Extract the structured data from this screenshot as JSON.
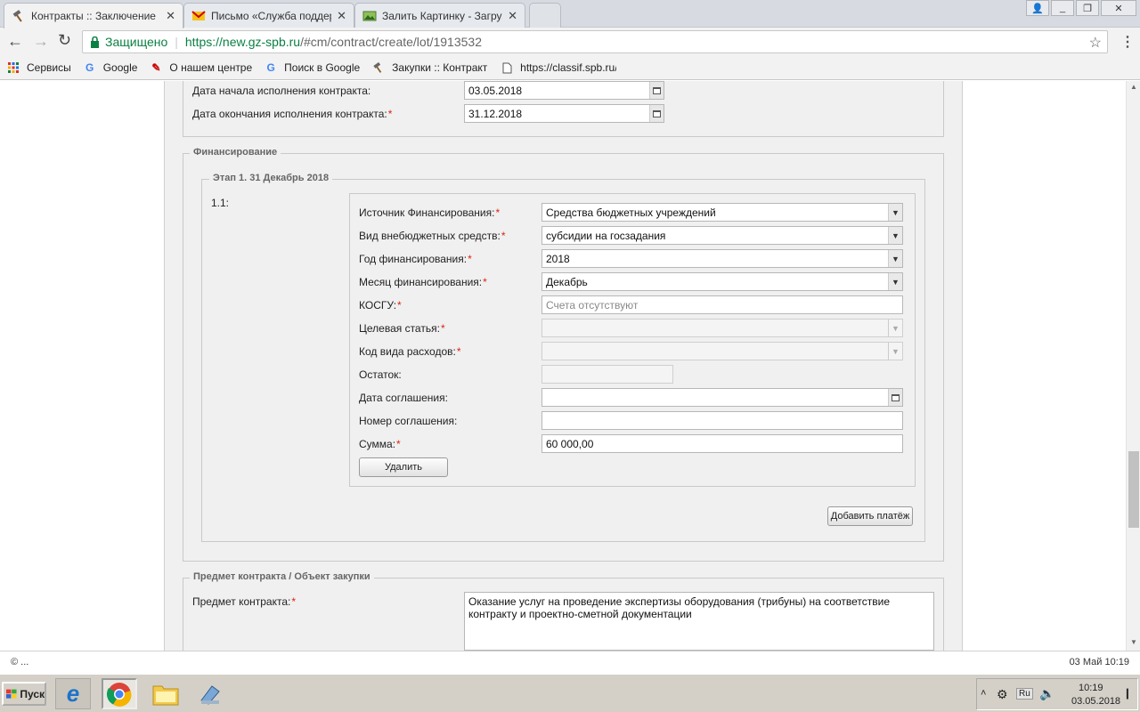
{
  "browser": {
    "tabs": [
      {
        "title": "Контракты :: Заключение",
        "icon": "hammer-icon"
      },
      {
        "title": "Письмо «Служба поддерж",
        "icon": "mail-icon"
      },
      {
        "title": "Залить Картинку - Загрузи",
        "icon": "image-icon"
      }
    ],
    "secure_label": "Защищено",
    "url_host": "https://new.gz-spb.ru",
    "url_path": "/#cm/contract/create/lot/1913532",
    "bookmarks": [
      {
        "label": "Сервисы",
        "icon": "apps-grid-icon"
      },
      {
        "label": "Google",
        "icon": "google-icon"
      },
      {
        "label": "О нашем центре",
        "icon": "sign-icon"
      },
      {
        "label": "Поиск в Google",
        "icon": "google-icon"
      },
      {
        "label": "Закупки :: Контракты",
        "icon": "hammer-icon"
      },
      {
        "label": "https://classif.spb.ru/c",
        "icon": "page-icon"
      }
    ]
  },
  "contract_dates": {
    "start_label": "Дата начала исполнения контракта:",
    "start_value": "03.05.2018",
    "end_label": "Дата окончания исполнения контракта:",
    "end_value": "31.12.2018"
  },
  "financing": {
    "legend": "Финансирование",
    "stage_legend": "Этап 1. 31 Декабрь 2018",
    "item_index": "1.1:",
    "fields": {
      "source_label": "Источник Финансирования:",
      "source_value": "Средства бюджетных учреждений",
      "extrabudget_label": "Вид внебюджетных средств:",
      "extrabudget_value": "субсидии на госзадания",
      "year_label": "Год финансирования:",
      "year_value": "2018",
      "month_label": "Месяц финансирования:",
      "month_value": "Декабрь",
      "kosgu_label": "КОСГУ:",
      "kosgu_placeholder": "Счета отсутствуют",
      "target_label": "Целевая статья:",
      "expense_code_label": "Код вида расходов:",
      "balance_label": "Остаток:",
      "agreement_date_label": "Дата соглашения:",
      "agreement_number_label": "Номер соглашения:",
      "sum_label": "Сумма:",
      "sum_value": "60 000,00"
    },
    "delete_button": "Удалить",
    "add_payment_button": "Добавить платёж"
  },
  "subject": {
    "legend": "Предмет контракта / Объект закупки",
    "label": "Предмет контракта:",
    "value": "Оказание услуг на проведение экспертизы оборудования (трибуны) на соответствие контракту и проектно-сметной документации"
  },
  "status_bar": {
    "left": "© ...",
    "right": "03 Май 10:19"
  },
  "taskbar": {
    "start_label": "Пуск",
    "lang": "Ru",
    "time": "10:19",
    "date": "03.05.2018"
  },
  "colors": {
    "required": "#dd1111",
    "secure_green": "#0b8043",
    "page_bg": "#f0f0f0"
  }
}
